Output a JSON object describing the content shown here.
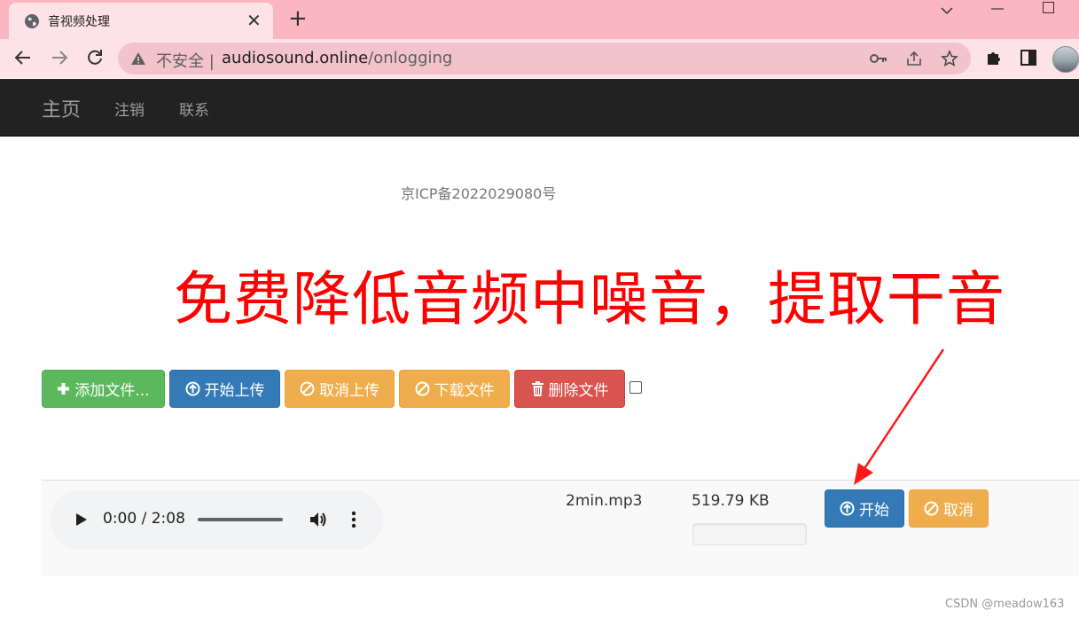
{
  "browser": {
    "tab_title": "音视频处理",
    "new_tab": "+",
    "tab_close": "✕",
    "security_label": "不安全",
    "separator": "|",
    "url_host": "audiosound.online",
    "url_path": "/onlogging"
  },
  "navbar": {
    "brand": "主页",
    "links": [
      "注销",
      "联系"
    ]
  },
  "page": {
    "icp": "京ICP备2022029080号",
    "headline": "免费降低音频中噪音，提取干音"
  },
  "toolbar": {
    "add_files": "添加文件...",
    "start_upload": "开始上传",
    "cancel_upload": "取消上传",
    "download_files": "下载文件",
    "delete_files": "删除文件"
  },
  "file": {
    "time": "0:00 / 2:08",
    "name": "2min.mp3",
    "size": "519.79 KB",
    "progress_percent": 0,
    "start_label": "开始",
    "cancel_label": "取消"
  },
  "colors": {
    "success": "#5cb85c",
    "primary": "#337ab7",
    "warning": "#f0ad4e",
    "danger": "#d9534f",
    "headline": "#ff0000",
    "navbar": "#222222"
  },
  "watermark": "CSDN @meadow163"
}
